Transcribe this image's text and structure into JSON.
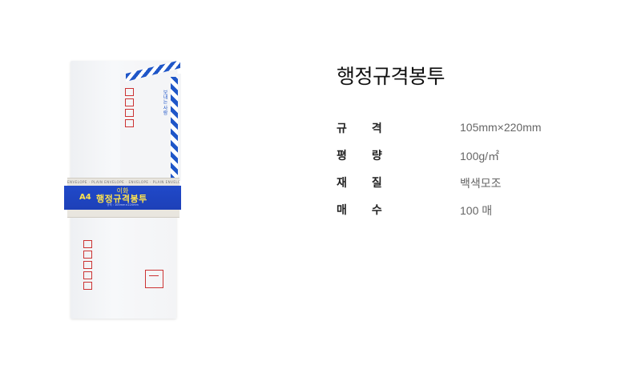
{
  "product": {
    "title": "행정규격봉투",
    "image": {
      "band_brand": "이화",
      "band_size_label": "A4",
      "band_name": "행정규격봉투",
      "band_size_text": "규격 : 105mm×220mm",
      "band_edge_text": "ENVELOPE · PLAIN ENVELOPE · ENVELOPE · PLAIN ENVELOPE",
      "vertical_text": "보내는 사람",
      "stamp_text": "우표",
      "colors": {
        "band": "#2049c9",
        "band_text": "#ffe34d",
        "stripe": "#1f56c8",
        "zip_box": "#cc3333"
      }
    }
  },
  "specs": [
    {
      "label": "규격",
      "value": "105mm×220mm"
    },
    {
      "label": "평량",
      "value": "100g/㎡"
    },
    {
      "label": "재질",
      "value": "백색모조"
    },
    {
      "label": "매수",
      "value": "100 매"
    }
  ]
}
